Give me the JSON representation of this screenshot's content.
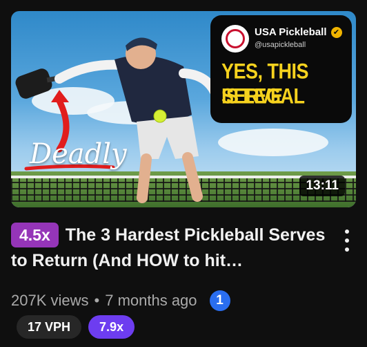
{
  "thumbnail": {
    "overlay_account_name": "USA Pickleball",
    "overlay_account_handle": "@usapickleball",
    "overlay_headline_line1": "YES, THIS SERVE",
    "overlay_headline_line2": "IS LEGAL",
    "overlay_word": "Deadly",
    "duration": "13:11",
    "verified_icon": "✔"
  },
  "video": {
    "multiplier_badge": "4.5x",
    "title": "The 3 Hardest Pickleball Serves to Return (And HOW to hit…",
    "views": "207K views",
    "separator": "•",
    "published": "7 months ago",
    "rank_badge": "1"
  },
  "chips": {
    "vph": "17 VPH",
    "multiplier": "7.9x"
  },
  "icons": {
    "menu": "more-vert-icon",
    "verified": "verified-check-icon"
  },
  "colors": {
    "background": "#0f0f0f",
    "badge_purple": "#9535b8",
    "chip_purple": "#6d3df0",
    "rank_blue": "#2a6ef0",
    "headline_yellow": "#f6d21e"
  }
}
